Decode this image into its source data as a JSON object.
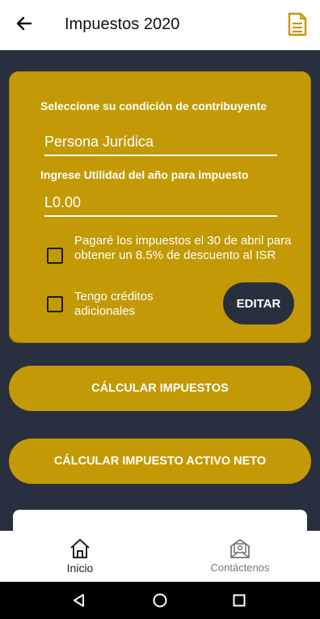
{
  "appbar": {
    "title": "Impuestos 2020"
  },
  "form": {
    "condition_label": "Seleccione su condición de contribuyente",
    "condition_value": "Persona Jurídica",
    "utility_label": "Ingrese Utilidad del año para impuesto",
    "utility_value": "L0.00",
    "checkbox1_label": "Pagaré los impuestos el 30 de abril para obtener un 8.5% de descuento al ISR",
    "checkbox1_checked": false,
    "checkbox2_label": "Tengo créditos adicionales",
    "checkbox2_checked": false,
    "edit_label": "EDITAR"
  },
  "actions": {
    "calc_taxes": "CÁLCULAR IMPUESTOS",
    "calc_net_asset": "CÁLCULAR IMPUESTO ACTIVO NETO"
  },
  "bottom_nav": {
    "items": [
      {
        "label": "Inicio",
        "icon": "home-icon",
        "active": true
      },
      {
        "label": "Contáctenos",
        "icon": "contact-mail-icon",
        "active": false
      }
    ]
  },
  "colors": {
    "accent": "#c39a06",
    "background": "#28303f",
    "text_light": "#ffffff"
  }
}
